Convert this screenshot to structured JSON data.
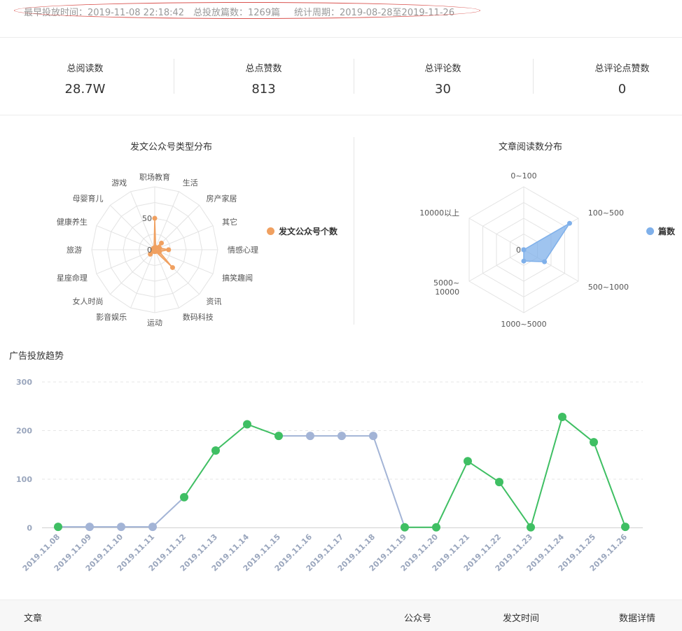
{
  "header": {
    "earliest": "最早投放时间：2019-11-08 22:18:42",
    "total_posts": "总投放篇数：1269篇",
    "period": "统计周期：2019-08-28至2019-11-26"
  },
  "stats": [
    {
      "label": "总阅读数",
      "value": "28.7W"
    },
    {
      "label": "总点赞数",
      "value": "813"
    },
    {
      "label": "总评论数",
      "value": "30"
    },
    {
      "label": "总评论点赞数",
      "value": "0"
    }
  ],
  "colors": {
    "orange": "#f0a060",
    "blue": "#7fb0ea",
    "green": "#3fbf63",
    "gray_blue": "#a3b4d6"
  },
  "table": {
    "col_article": "文章",
    "col_account": "公众号",
    "col_time": "发文时间",
    "col_detail": "数据详情"
  },
  "chart_data": [
    {
      "type": "radar",
      "title": "发文公众号类型分布",
      "indicators": [
        "职场教育",
        "生活",
        "房产家居",
        "其它",
        "情感心理",
        "搞笑趣闻",
        "资讯",
        "数码科技",
        "运动",
        "影音娱乐",
        "女人时尚",
        "星座命理",
        "旅游",
        "健康养生",
        "母婴育儿",
        "游戏"
      ],
      "tick_labels": [
        "0",
        "50"
      ],
      "max": 100,
      "series": [
        {
          "name": "发文公众号个数",
          "values": [
            50,
            4,
            15,
            8,
            22,
            8,
            40,
            3,
            3,
            3,
            10,
            3,
            3,
            3,
            3,
            3
          ]
        }
      ]
    },
    {
      "type": "radar",
      "title": "文章阅读数分布",
      "indicators": [
        "0~100",
        "100~500",
        "500~1000",
        "1000~5000",
        "5000~\n10000",
        "10000以上"
      ],
      "indicator_lines": [
        [
          "0~100"
        ],
        [
          "100~500"
        ],
        [
          "500~1000"
        ],
        [
          "1000~5000"
        ],
        [
          "5000~",
          "10000"
        ],
        [
          "10000以上"
        ]
      ],
      "tick_labels": [
        "0"
      ],
      "max": 100,
      "series": [
        {
          "name": "篇数",
          "values": [
            0,
            84,
            38,
            18,
            0,
            0
          ]
        }
      ]
    },
    {
      "type": "line",
      "title": "广告投放趋势",
      "categories": [
        "2019.11.08",
        "2019.11.09",
        "2019.11.10",
        "2019.11.11",
        "2019.11.12",
        "2019.11.13",
        "2019.11.14",
        "2019.11.15",
        "2019.11.16",
        "2019.11.17",
        "2019.11.18",
        "2019.11.19",
        "2019.11.20",
        "2019.11.21",
        "2019.11.22",
        "2019.11.23",
        "2019.11.24",
        "2019.11.25",
        "2019.11.26"
      ],
      "values": [
        2,
        2,
        2,
        2,
        63,
        159,
        213,
        189,
        189,
        189,
        189,
        1,
        1,
        137,
        94,
        1,
        228,
        176,
        2
      ],
      "point_colors": [
        "green",
        "gray",
        "gray",
        "gray",
        "green",
        "green",
        "green",
        "green",
        "gray",
        "gray",
        "gray",
        "green",
        "green",
        "green",
        "green",
        "green",
        "green",
        "green",
        "green"
      ],
      "yticks": [
        0,
        100,
        200,
        300
      ],
      "ylim": [
        0,
        300
      ],
      "grid": true
    }
  ]
}
